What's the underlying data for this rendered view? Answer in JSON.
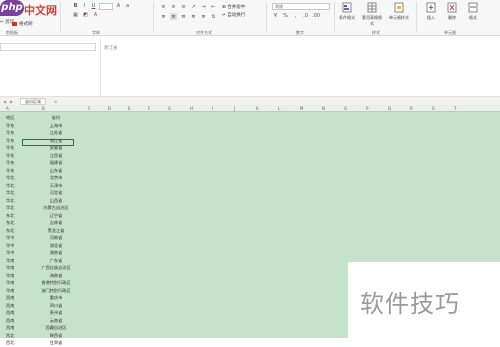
{
  "logo": {
    "php": "php",
    "cn": "中文网"
  },
  "clipboard": {
    "cut": "剪切",
    "format_painter": "格式刷",
    "group": "剪贴板"
  },
  "font": {
    "group": "字体",
    "bold": "B",
    "italic": "I",
    "underline": "U"
  },
  "alignment": {
    "merge": "合并居中",
    "wrap": "自动换行",
    "group": "对齐方式"
  },
  "number": {
    "format_value": "常规",
    "group": "数字"
  },
  "styles": {
    "cond_format": "条件格式",
    "table_style": "套用表格格式",
    "cell_style": "单元格样式",
    "group": "样式"
  },
  "cells": {
    "insert": "插入",
    "delete": "删除",
    "format": "格式",
    "group": "单元格"
  },
  "formula_bar": {
    "value": "浙江省"
  },
  "sheet_tab": "省份区域",
  "columns": [
    "A",
    "B",
    "C",
    "D",
    "E",
    "F",
    "G",
    "H",
    "I",
    "J",
    "K",
    "L",
    "M",
    "N",
    "O",
    "P",
    "Q",
    "R",
    "S",
    "T"
  ],
  "rows": [
    {
      "a": "地区",
      "b": "省份"
    },
    {
      "a": "华东",
      "b": "上海市"
    },
    {
      "a": "华东",
      "b": "江苏省"
    },
    {
      "a": "华东",
      "b": "浙江省"
    },
    {
      "a": "华东",
      "b": "安徽省"
    },
    {
      "a": "华东",
      "b": "江西省"
    },
    {
      "a": "华东",
      "b": "福建省"
    },
    {
      "a": "华东",
      "b": "山东省"
    },
    {
      "a": "华北",
      "b": "北京市"
    },
    {
      "a": "华北",
      "b": "天津市"
    },
    {
      "a": "华北",
      "b": "河北省"
    },
    {
      "a": "华北",
      "b": "山西省"
    },
    {
      "a": "华北",
      "b": "内蒙古自治区"
    },
    {
      "a": "东北",
      "b": "辽宁省"
    },
    {
      "a": "东北",
      "b": "吉林省"
    },
    {
      "a": "东北",
      "b": "黑龙江省"
    },
    {
      "a": "华中",
      "b": "河南省"
    },
    {
      "a": "华中",
      "b": "湖北省"
    },
    {
      "a": "华中",
      "b": "湖南省"
    },
    {
      "a": "华南",
      "b": "广东省"
    },
    {
      "a": "华南",
      "b": "广西壮族自治区"
    },
    {
      "a": "华南",
      "b": "海南省"
    },
    {
      "a": "华南",
      "b": "香港特别行政区"
    },
    {
      "a": "华南",
      "b": "澳门特别行政区"
    },
    {
      "a": "西南",
      "b": "重庆市"
    },
    {
      "a": "西南",
      "b": "四川省"
    },
    {
      "a": "西南",
      "b": "贵州省"
    },
    {
      "a": "西南",
      "b": "云南省"
    },
    {
      "a": "西南",
      "b": "西藏自治区"
    },
    {
      "a": "西北",
      "b": "陕西省"
    },
    {
      "a": "西北",
      "b": "甘肃省"
    }
  ],
  "watermark": "软件技巧",
  "colors": {
    "sheet_bg": "#c5e2cb",
    "selection": "#1f7a3a",
    "logo_purple": "#7b3fa0",
    "logo_red": "#e03a3a"
  }
}
